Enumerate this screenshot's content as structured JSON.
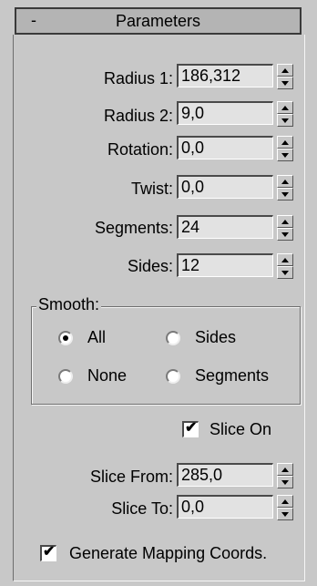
{
  "rollout": {
    "toggle": "-",
    "title": "Parameters"
  },
  "params": [
    {
      "label": "Radius 1:",
      "value": "186,312"
    },
    {
      "label": "Radius 2:",
      "value": "9,0"
    },
    {
      "label": "Rotation:",
      "value": "0,0"
    },
    {
      "label": "Twist:",
      "value": "0,0"
    },
    {
      "label": "Segments:",
      "value": "24"
    },
    {
      "label": "Sides:",
      "value": "12"
    }
  ],
  "smooth": {
    "title": "Smooth:",
    "options": [
      {
        "label": "All",
        "checked": true
      },
      {
        "label": "Sides",
        "checked": false
      },
      {
        "label": "None",
        "checked": false
      },
      {
        "label": "Segments",
        "checked": false
      }
    ]
  },
  "slice": {
    "slice_on_label": "Slice On",
    "slice_on_checked": true,
    "from_label": "Slice From:",
    "from_value": "285,0",
    "to_label": "Slice To:",
    "to_value": "0,0"
  },
  "mapping": {
    "label": "Generate Mapping Coords.",
    "checked": true
  }
}
